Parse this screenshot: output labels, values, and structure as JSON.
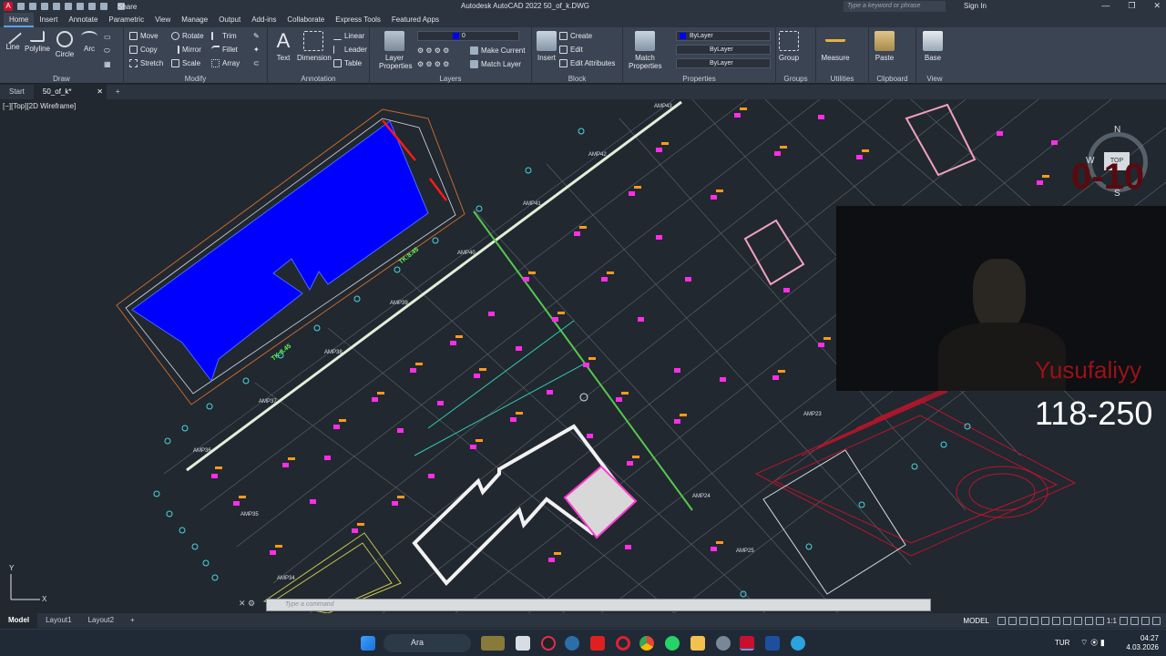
{
  "titlebar": {
    "share_label": "Share",
    "title": "Autodesk AutoCAD 2022    50_of_k.DWG",
    "search_placeholder": "Type a keyword or phrase",
    "signin_label": "Sign In"
  },
  "menu": {
    "tabs": [
      "Home",
      "Insert",
      "Annotate",
      "Parametric",
      "View",
      "Manage",
      "Output",
      "Add-ins",
      "Collaborate",
      "Express Tools",
      "Featured Apps"
    ]
  },
  "ribbon": {
    "draw": {
      "line": "Line",
      "polyline": "Polyline",
      "circle": "Circle",
      "arc": "Arc",
      "label": "Draw"
    },
    "modify": {
      "move": "Move",
      "rotate": "Rotate",
      "trim": "Trim",
      "copy": "Copy",
      "mirror": "Mirror",
      "fillet": "Fillet",
      "stretch": "Stretch",
      "scale": "Scale",
      "array": "Array",
      "label": "Modify"
    },
    "annotation": {
      "text": "Text",
      "dimension": "Dimension",
      "linear": "Linear",
      "leader": "Leader",
      "table": "Table",
      "label": "Annotation"
    },
    "layers": {
      "layer_properties": "Layer\nProperties",
      "current_layer": "0",
      "make_current": "Make Current",
      "match_layer": "Match Layer",
      "label": "Layers"
    },
    "block": {
      "insert": "Insert",
      "create": "Create",
      "edit": "Edit",
      "edit_attributes": "Edit Attributes",
      "label": "Block"
    },
    "properties": {
      "match": "Match\nProperties",
      "color": "ByLayer",
      "linetype": "ByLayer",
      "lineweight": "ByLayer",
      "label": "Properties"
    },
    "groups": {
      "group": "Group",
      "label": "Groups"
    },
    "utilities": {
      "measure": "Measure",
      "label": "Utilities"
    },
    "clipboard": {
      "paste": "Paste",
      "label": "Clipboard"
    },
    "view": {
      "base": "Base",
      "label": "View"
    }
  },
  "doc_tabs": {
    "start": "Start",
    "file": "50_of_k*"
  },
  "viewport": {
    "label": "[−][Top][2D Wireframe]",
    "levels": [
      "TK:8.45",
      "TK:8.45"
    ],
    "amp_labels": [
      "AMP43",
      "AMP42",
      "AMP41",
      "AMP40",
      "AMP39",
      "AMP38",
      "AMP37",
      "AMP36",
      "AMP35",
      "AMP34",
      "AMP23",
      "AMP24",
      "AMP25"
    ],
    "viewcube": {
      "n": "N",
      "w": "W",
      "s": "S",
      "top": "TOP"
    }
  },
  "overlay": {
    "top_range": "0-10",
    "name": "Yusufaliyy",
    "range": "118-250"
  },
  "command": {
    "placeholder": "Type a command"
  },
  "layout_tabs": [
    "Model",
    "Layout1",
    "Layout2"
  ],
  "status": {
    "model": "MODEL",
    "scale": "1:1"
  },
  "taskbar": {
    "search": "Ara",
    "lang": "TUR",
    "time": "04:27",
    "date": "4.03.2026"
  },
  "colors": {
    "ribbon_bg": "#3b4453",
    "canvas_bg": "#212830",
    "accent": "#5a9ff5",
    "blue_fill": "#0000ff",
    "magenta": "#ff00ff"
  }
}
